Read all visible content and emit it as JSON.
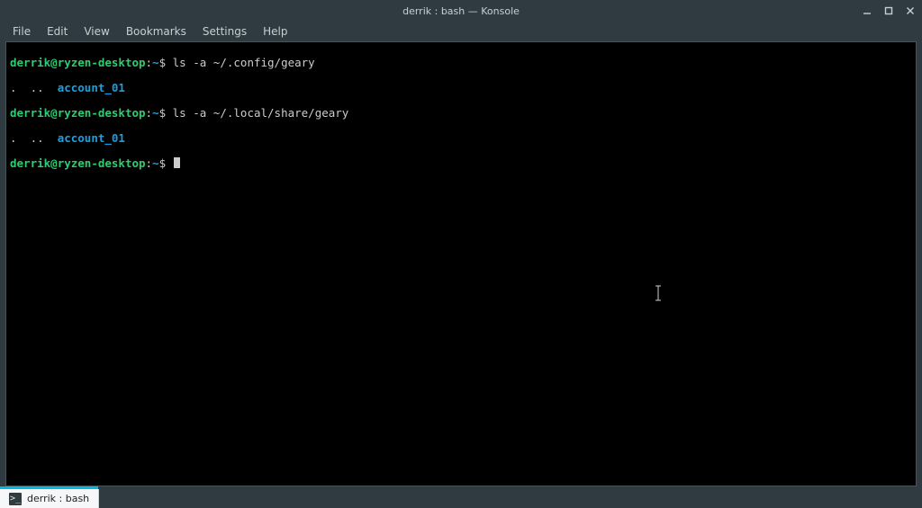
{
  "window": {
    "title": "derrik : bash — Konsole"
  },
  "menu": {
    "file": "File",
    "edit": "Edit",
    "view": "View",
    "bookmarks": "Bookmarks",
    "settings": "Settings",
    "help": "Help"
  },
  "terminal": {
    "prompt": {
      "user": "derrik",
      "at": "@",
      "host": "ryzen-desktop",
      "colon": ":",
      "path": "~",
      "sigil": "$"
    },
    "lines": {
      "cmd1": "ls -a ~/.config/geary",
      "out_dots": ".  ..  ",
      "out_dir": "account_01",
      "cmd2": "ls -a ~/.local/share/geary"
    }
  },
  "tabs": {
    "active": {
      "icon_glyph": ">_",
      "label": "derrik : bash"
    }
  }
}
